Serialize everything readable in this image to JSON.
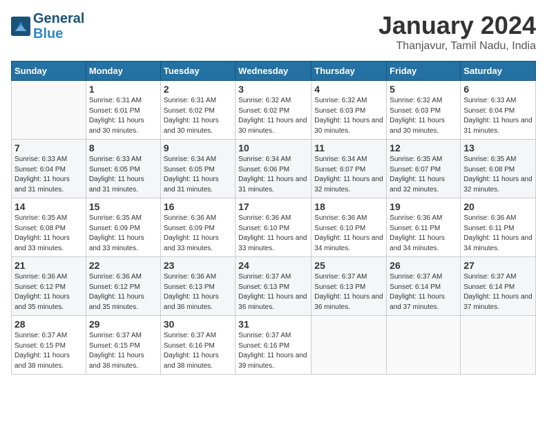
{
  "header": {
    "logo_line1": "General",
    "logo_line2": "Blue",
    "title": "January 2024",
    "subtitle": "Thanjavur, Tamil Nadu, India"
  },
  "days_of_week": [
    "Sunday",
    "Monday",
    "Tuesday",
    "Wednesday",
    "Thursday",
    "Friday",
    "Saturday"
  ],
  "weeks": [
    [
      {
        "day": "",
        "info": ""
      },
      {
        "day": "1",
        "info": "Sunrise: 6:31 AM\nSunset: 6:01 PM\nDaylight: 11 hours\nand 30 minutes."
      },
      {
        "day": "2",
        "info": "Sunrise: 6:31 AM\nSunset: 6:02 PM\nDaylight: 11 hours\nand 30 minutes."
      },
      {
        "day": "3",
        "info": "Sunrise: 6:32 AM\nSunset: 6:02 PM\nDaylight: 11 hours\nand 30 minutes."
      },
      {
        "day": "4",
        "info": "Sunrise: 6:32 AM\nSunset: 6:03 PM\nDaylight: 11 hours\nand 30 minutes."
      },
      {
        "day": "5",
        "info": "Sunrise: 6:32 AM\nSunset: 6:03 PM\nDaylight: 11 hours\nand 30 minutes."
      },
      {
        "day": "6",
        "info": "Sunrise: 6:33 AM\nSunset: 6:04 PM\nDaylight: 11 hours\nand 31 minutes."
      }
    ],
    [
      {
        "day": "7",
        "info": "Sunrise: 6:33 AM\nSunset: 6:04 PM\nDaylight: 11 hours\nand 31 minutes."
      },
      {
        "day": "8",
        "info": "Sunrise: 6:33 AM\nSunset: 6:05 PM\nDaylight: 11 hours\nand 31 minutes."
      },
      {
        "day": "9",
        "info": "Sunrise: 6:34 AM\nSunset: 6:05 PM\nDaylight: 11 hours\nand 31 minutes."
      },
      {
        "day": "10",
        "info": "Sunrise: 6:34 AM\nSunset: 6:06 PM\nDaylight: 11 hours\nand 31 minutes."
      },
      {
        "day": "11",
        "info": "Sunrise: 6:34 AM\nSunset: 6:07 PM\nDaylight: 11 hours\nand 32 minutes."
      },
      {
        "day": "12",
        "info": "Sunrise: 6:35 AM\nSunset: 6:07 PM\nDaylight: 11 hours\nand 32 minutes."
      },
      {
        "day": "13",
        "info": "Sunrise: 6:35 AM\nSunset: 6:08 PM\nDaylight: 11 hours\nand 32 minutes."
      }
    ],
    [
      {
        "day": "14",
        "info": "Sunrise: 6:35 AM\nSunset: 6:08 PM\nDaylight: 11 hours\nand 33 minutes."
      },
      {
        "day": "15",
        "info": "Sunrise: 6:35 AM\nSunset: 6:09 PM\nDaylight: 11 hours\nand 33 minutes."
      },
      {
        "day": "16",
        "info": "Sunrise: 6:36 AM\nSunset: 6:09 PM\nDaylight: 11 hours\nand 33 minutes."
      },
      {
        "day": "17",
        "info": "Sunrise: 6:36 AM\nSunset: 6:10 PM\nDaylight: 11 hours\nand 33 minutes."
      },
      {
        "day": "18",
        "info": "Sunrise: 6:36 AM\nSunset: 6:10 PM\nDaylight: 11 hours\nand 34 minutes."
      },
      {
        "day": "19",
        "info": "Sunrise: 6:36 AM\nSunset: 6:11 PM\nDaylight: 11 hours\nand 34 minutes."
      },
      {
        "day": "20",
        "info": "Sunrise: 6:36 AM\nSunset: 6:11 PM\nDaylight: 11 hours\nand 34 minutes."
      }
    ],
    [
      {
        "day": "21",
        "info": "Sunrise: 6:36 AM\nSunset: 6:12 PM\nDaylight: 11 hours\nand 35 minutes."
      },
      {
        "day": "22",
        "info": "Sunrise: 6:36 AM\nSunset: 6:12 PM\nDaylight: 11 hours\nand 35 minutes."
      },
      {
        "day": "23",
        "info": "Sunrise: 6:36 AM\nSunset: 6:13 PM\nDaylight: 11 hours\nand 36 minutes."
      },
      {
        "day": "24",
        "info": "Sunrise: 6:37 AM\nSunset: 6:13 PM\nDaylight: 11 hours\nand 36 minutes."
      },
      {
        "day": "25",
        "info": "Sunrise: 6:37 AM\nSunset: 6:13 PM\nDaylight: 11 hours\nand 36 minutes."
      },
      {
        "day": "26",
        "info": "Sunrise: 6:37 AM\nSunset: 6:14 PM\nDaylight: 11 hours\nand 37 minutes."
      },
      {
        "day": "27",
        "info": "Sunrise: 6:37 AM\nSunset: 6:14 PM\nDaylight: 11 hours\nand 37 minutes."
      }
    ],
    [
      {
        "day": "28",
        "info": "Sunrise: 6:37 AM\nSunset: 6:15 PM\nDaylight: 11 hours\nand 38 minutes."
      },
      {
        "day": "29",
        "info": "Sunrise: 6:37 AM\nSunset: 6:15 PM\nDaylight: 11 hours\nand 38 minutes."
      },
      {
        "day": "30",
        "info": "Sunrise: 6:37 AM\nSunset: 6:16 PM\nDaylight: 11 hours\nand 38 minutes."
      },
      {
        "day": "31",
        "info": "Sunrise: 6:37 AM\nSunset: 6:16 PM\nDaylight: 11 hours\nand 39 minutes."
      },
      {
        "day": "",
        "info": ""
      },
      {
        "day": "",
        "info": ""
      },
      {
        "day": "",
        "info": ""
      }
    ]
  ]
}
